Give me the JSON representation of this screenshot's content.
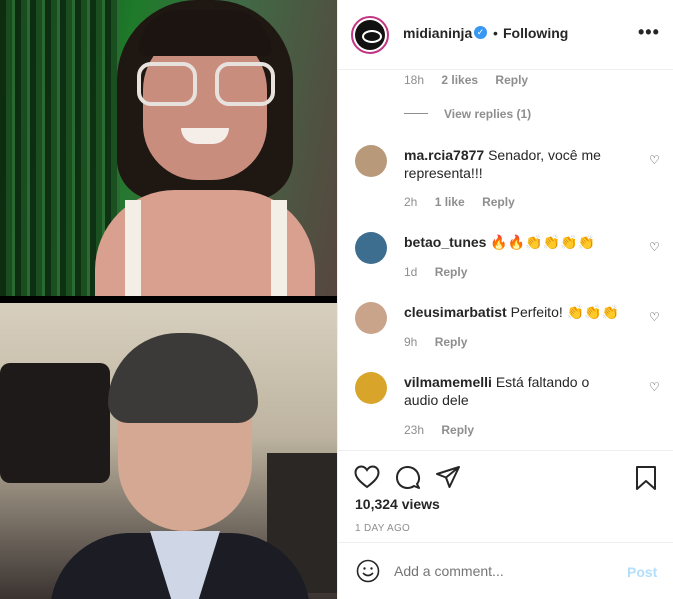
{
  "header": {
    "username": "midianinja",
    "verified_symbol": "✓",
    "separator": "•",
    "follow_status": "Following",
    "more_symbol": "•••"
  },
  "reply_meta": {
    "time": "18h",
    "likes": "2 likes",
    "reply": "Reply"
  },
  "view_replies": "View replies (1)",
  "comments": [
    {
      "user": "ma.rcia7877",
      "text": "Senador, você me representa!!!",
      "time": "2h",
      "likes": "1 like",
      "reply": "Reply",
      "avatar_color": "#b89a7a"
    },
    {
      "user": "betao_tunes",
      "text": "🔥🔥👏👏👏👏",
      "time": "1d",
      "likes": "",
      "reply": "Reply",
      "avatar_color": "#3d6e8f"
    },
    {
      "user": "cleusimarbatist",
      "text": "Perfeito! 👏👏👏",
      "time": "9h",
      "likes": "",
      "reply": "Reply",
      "avatar_color": "#c9a48a"
    },
    {
      "user": "vilmamemelli",
      "text": "Está faltando o audio dele",
      "time": "23h",
      "likes": "",
      "reply": "Reply",
      "avatar_color": "#d8a52a"
    }
  ],
  "stats": {
    "views": "10,324 views",
    "date": "1 DAY AGO"
  },
  "add_comment": {
    "placeholder": "Add a comment...",
    "post": "Post"
  },
  "icons": [
    "heart-icon",
    "comment-icon",
    "share-icon",
    "bookmark-icon",
    "smiley-icon",
    "more-options-icon",
    "verified-badge-icon"
  ]
}
